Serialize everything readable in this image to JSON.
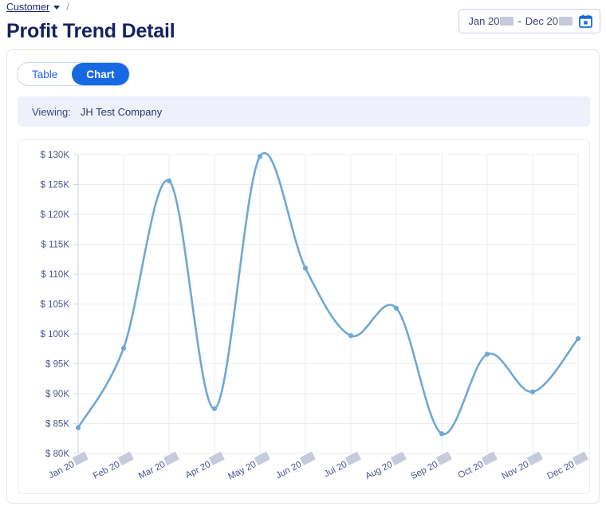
{
  "breadcrumb": {
    "link": "Customer",
    "separator": "/",
    "caret_icon": "chevron-down-icon"
  },
  "header": {
    "title": "Profit Trend Detail"
  },
  "date_range": {
    "start_month": "Jan 20",
    "separator": "-",
    "end_month": "Dec 20",
    "calendar_icon": "calendar-icon",
    "start_year_redacted": true,
    "end_year_redacted": true
  },
  "tabs": [
    {
      "label": "Table",
      "active": false
    },
    {
      "label": "Chart",
      "active": true
    }
  ],
  "viewing": {
    "label": "Viewing:",
    "value": "JH Test Company"
  },
  "colors": {
    "accent": "#1668e3",
    "line": "#6fa8d4",
    "title": "#14225e",
    "banner_bg": "#eef0fb",
    "grid": "#eceef3",
    "tick_text": "#4b5490"
  },
  "chart_data": {
    "type": "line",
    "title": "",
    "xlabel": "",
    "ylabel": "",
    "ylim": [
      80000,
      130000
    ],
    "ytick_step": 5000,
    "grid": true,
    "legend": "none",
    "curve": "smooth",
    "categories": [
      "Jan 20",
      "Feb 20",
      "Mar 20",
      "Apr 20",
      "May 20",
      "Jun 20",
      "Jul 20",
      "Aug 20",
      "Sep 20",
      "Oct 20",
      "Nov 20",
      "Dec 20"
    ],
    "ytick_labels": [
      "$ 130K",
      "$ 125K",
      "$ 120K",
      "$ 115K",
      "$ 110K",
      "$ 105K",
      "$ 100K",
      "$ 95K",
      "$ 90K",
      "$ 85K",
      "$ 80K"
    ],
    "ytick_values": [
      130000,
      125000,
      120000,
      115000,
      110000,
      105000,
      100000,
      95000,
      90000,
      85000,
      80000
    ],
    "series": [
      {
        "name": "Profit",
        "values": [
          84300,
          97600,
          125600,
          87500,
          129700,
          111000,
          99700,
          104300,
          83300,
          96600,
          90300,
          99200
        ]
      }
    ]
  }
}
